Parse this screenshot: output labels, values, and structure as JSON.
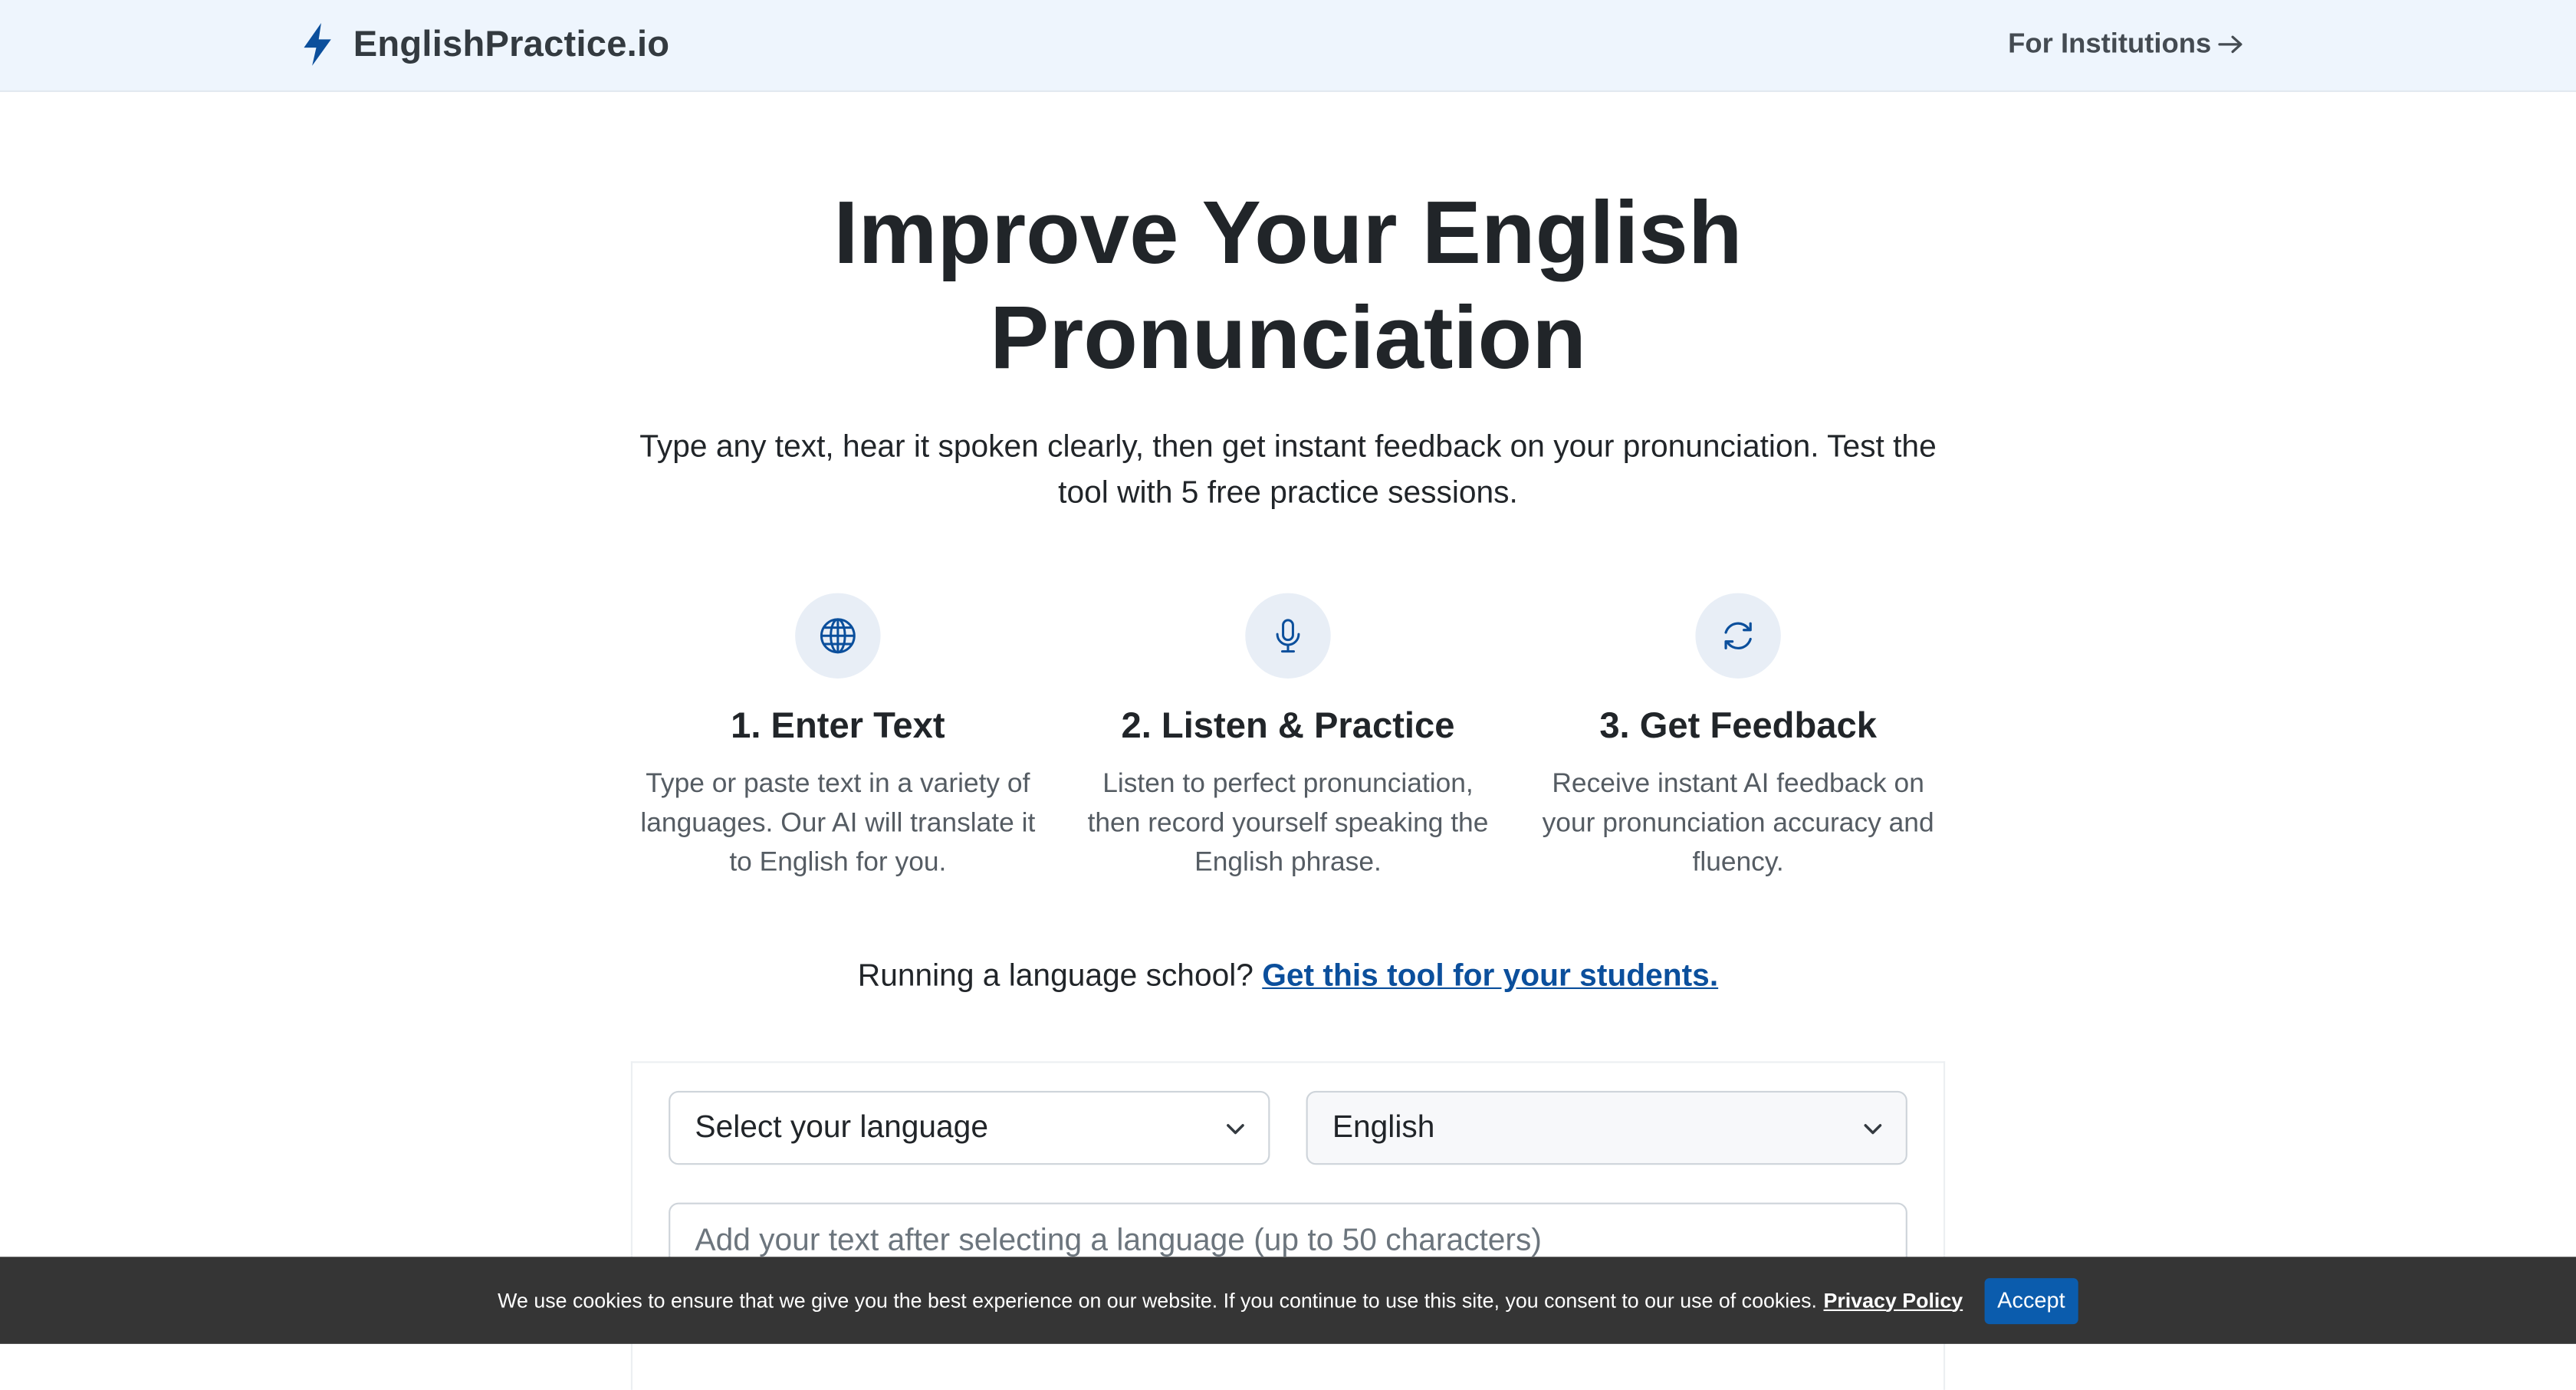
{
  "header": {
    "brand": "EnglishPractice.io",
    "institutions_link": "For Institutions"
  },
  "hero": {
    "title_line1": "Improve Your English",
    "title_line2": "Pronunciation",
    "subtitle": "Type any text, hear it spoken clearly, then get instant feedback on your pronunciation. Test the tool with 5 free practice sessions."
  },
  "steps": [
    {
      "icon": "globe-icon",
      "title": "1. Enter Text",
      "description": "Type or paste text in a variety of languages. Our AI will translate it to English for you."
    },
    {
      "icon": "microphone-icon",
      "title": "2. Listen & Practice",
      "description": "Listen to perfect pronunciation, then record yourself speaking the English phrase."
    },
    {
      "icon": "refresh-icon",
      "title": "3. Get Feedback",
      "description": "Receive instant AI feedback on your pronunciation accuracy and fluency."
    }
  ],
  "school": {
    "prompt": "Running a language school?",
    "link": "Get this tool for your students."
  },
  "form": {
    "source_language": "Select your language",
    "target_language": "English",
    "text_placeholder": "Add your text after selecting a language (up to 50 characters)"
  },
  "cookie": {
    "message": "We use cookies to ensure that we give you the best experience on our website. If you continue to use this site, you consent to our use of cookies.",
    "privacy_link": "Privacy Policy",
    "accept_label": "Accept"
  },
  "colors": {
    "header_bg": "#eef5fd",
    "accent": "#0b4f9c",
    "cookie_bg": "#353535",
    "accept_button": "#0b5cad"
  }
}
